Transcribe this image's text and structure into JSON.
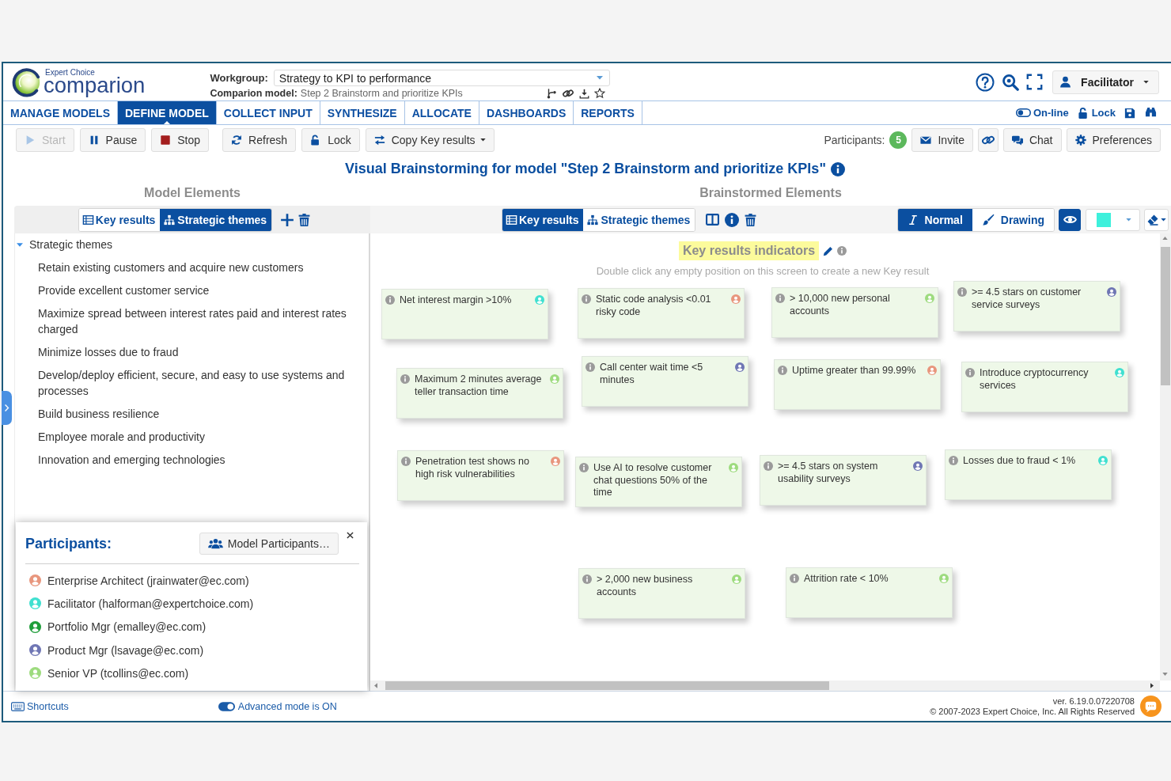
{
  "header": {
    "logo": {
      "brand": "Expert Choice",
      "product": "comparion"
    },
    "workgroup": {
      "label": "Workgroup:",
      "value": "Strategy to KPI to performance"
    },
    "model": {
      "label": "Comparion model:",
      "value": "Step 2 Brainstorm and prioritize KPIs"
    },
    "user_menu": {
      "label": "Facilitator"
    }
  },
  "nav": {
    "tabs": [
      {
        "label": "MANAGE MODELS",
        "selected": false
      },
      {
        "label": "DEFINE MODEL",
        "selected": true
      },
      {
        "label": "COLLECT INPUT",
        "selected": false
      },
      {
        "label": "SYNTHESIZE",
        "selected": false
      },
      {
        "label": "ALLOCATE",
        "selected": false
      },
      {
        "label": "DASHBOARDS",
        "selected": false
      },
      {
        "label": "REPORTS",
        "selected": false
      }
    ],
    "online": {
      "label": "On-line",
      "on": true
    },
    "lock": {
      "label": "Lock"
    }
  },
  "toolbar": {
    "groups": [
      [
        {
          "kind": "start",
          "label": "Start",
          "disabled": true
        },
        {
          "kind": "pause",
          "label": "Pause",
          "disabled": false
        },
        {
          "kind": "stop",
          "label": "Stop",
          "disabled": false
        }
      ],
      [
        {
          "kind": "refresh",
          "label": "Refresh",
          "disabled": false
        },
        {
          "kind": "lock",
          "label": "Lock",
          "disabled": false
        },
        {
          "kind": "copy",
          "label": "Copy Key results",
          "disabled": false
        }
      ]
    ],
    "participants": {
      "label": "Participants:",
      "count": "5"
    },
    "actions": [
      {
        "kind": "invite",
        "label": "Invite"
      },
      {
        "kind": "link"
      },
      {
        "kind": "chat",
        "label": "Chat"
      },
      {
        "kind": "preferences",
        "label": "Preferences"
      }
    ]
  },
  "page": {
    "title": "Visual Brainstorming for model \"Step 2 Brainstorm and prioritize KPIs\""
  },
  "model_elements": {
    "heading": "Model Elements",
    "tabs": [
      {
        "label": "Key results",
        "selected": false
      },
      {
        "label": "Strategic themes",
        "selected": true
      }
    ],
    "tree": [
      {
        "label": "Strategic themes",
        "expanded": true,
        "children": [
          {
            "label": "Retain existing customers and acquire new customers"
          },
          {
            "label": "Provide excellent customer service"
          },
          {
            "label": "Maximize spread between interest rates paid and interest rates charged"
          },
          {
            "label": "Minimize losses due to fraud"
          },
          {
            "label": "Develop/deploy efficient, secure, and easy to use systems and processes"
          },
          {
            "label": "Build business resilience"
          },
          {
            "label": "Employee morale and productivity"
          },
          {
            "label": "Innovation and emerging technologies"
          }
        ]
      }
    ]
  },
  "participants_panel": {
    "title": "Participants:",
    "button": "Model Participants…",
    "participants": [
      {
        "name": "Enterprise Architect (jrainwater@ec.com)",
        "color": "#e8967d"
      },
      {
        "name": "Facilitator (halforman@expertchoice.com)",
        "color": "#40e0d0"
      },
      {
        "name": "Portfolio Mgr (emalley@ec.com)",
        "color": "#1f9d3a"
      },
      {
        "name": "Product Mgr (lsavage@ec.com)",
        "color": "#6f76b4"
      },
      {
        "name": "Senior VP (tcollins@ec.com)",
        "color": "#9ddb7e"
      }
    ]
  },
  "brainstormed_elements": {
    "heading": "Brainstormed Elements",
    "tabs": [
      {
        "label": "Key results",
        "selected": true
      },
      {
        "label": "Strategic themes",
        "selected": false
      }
    ],
    "modes": [
      {
        "label": "Normal",
        "selected": true
      },
      {
        "label": "Drawing",
        "selected": false
      }
    ],
    "preview": {
      "on": true
    },
    "color_picker": {
      "color": "#3ef0dc"
    },
    "canvas": {
      "title": "Key results indicators",
      "hint": "Double click any empty position on this screen to create a new Key result",
      "cards": [
        {
          "text": "Net interest margin >10%",
          "color": "#40e0d0"
        },
        {
          "text": "Static code analysis <0.01 risky code",
          "color": "#e8967d"
        },
        {
          "text": "> 10,000 new personal accounts",
          "color": "#9ddb7e"
        },
        {
          "text": ">= 4.5 stars on customer service surveys",
          "color": "#6f76b4"
        },
        {
          "text": "Maximum 2 minutes average teller transaction time",
          "color": "#9ddb7e"
        },
        {
          "text": "Call center wait time <5 minutes",
          "color": "#6f76b4"
        },
        {
          "text": "Uptime greater than 99.99%",
          "color": "#e8967d"
        },
        {
          "text": "Introduce cryptocurrency services",
          "color": "#40e0d0"
        },
        {
          "text": "Penetration test shows no high risk vulnerabilities",
          "color": "#e8967d"
        },
        {
          "text": "Use AI to resolve customer chat questions 50% of the time",
          "color": "#9ddb7e"
        },
        {
          "text": ">= 4.5 stars on system usability surveys",
          "color": "#6f76b4"
        },
        {
          "text": "Losses due to fraud < 1%",
          "color": "#40e0d0"
        },
        {
          "text": "> 2,000 new business accounts",
          "color": "#9ddb7e"
        },
        {
          "text": "Attrition rate < 10%",
          "color": "#9ddb7e"
        }
      ]
    }
  },
  "footer": {
    "shortcuts": "Shortcuts",
    "advanced_mode": {
      "label": "Advanced mode is ON",
      "on": true
    },
    "version": "ver. 6.19.0.07220708",
    "copyright": "© 2007-2023 Expert Choice, Inc. All Rights Reserved"
  }
}
